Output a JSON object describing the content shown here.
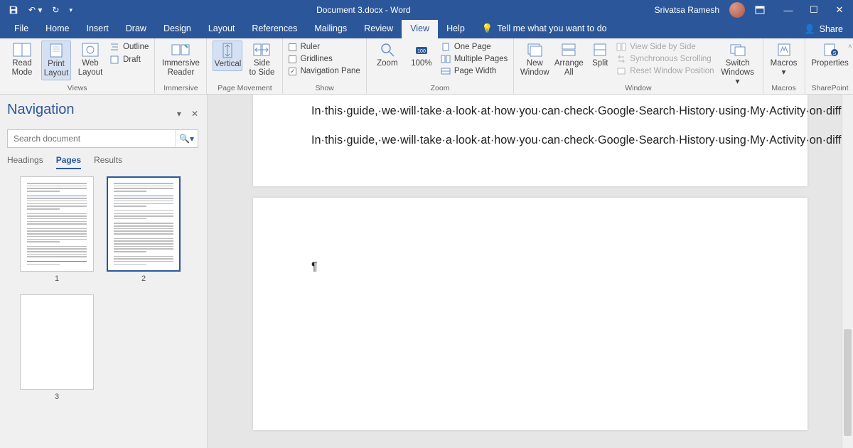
{
  "titlebar": {
    "doc_title": "Document 3.docx  -  Word",
    "user_name": "Srivatsa Ramesh"
  },
  "tabs": {
    "items": [
      "File",
      "Home",
      "Insert",
      "Draw",
      "Design",
      "Layout",
      "References",
      "Mailings",
      "Review",
      "View",
      "Help"
    ],
    "active": "View",
    "tell_me": "Tell me what you want to do",
    "share": "Share"
  },
  "ribbon": {
    "views": {
      "label": "Views",
      "read_mode": "Read\nMode",
      "print_layout": "Print\nLayout",
      "web_layout": "Web\nLayout",
      "outline": "Outline",
      "draft": "Draft"
    },
    "immersive": {
      "label": "Immersive",
      "reader": "Immersive\nReader"
    },
    "page_movement": {
      "label": "Page Movement",
      "vertical": "Vertical",
      "side": "Side\nto Side"
    },
    "show": {
      "label": "Show",
      "ruler": "Ruler",
      "gridlines": "Gridlines",
      "nav_pane": "Navigation Pane"
    },
    "zoom": {
      "label": "Zoom",
      "zoom": "Zoom",
      "hundred": "100%",
      "one_page": "One Page",
      "multiple": "Multiple Pages",
      "page_width": "Page Width"
    },
    "window": {
      "label": "Window",
      "new_window": "New\nWindow",
      "arrange_all": "Arrange\nAll",
      "split": "Split",
      "side_by_side": "View Side by Side",
      "sync": "Synchronous Scrolling",
      "reset": "Reset Window Position",
      "switch": "Switch\nWindows"
    },
    "macros": {
      "label": "Macros",
      "btn": "Macros"
    },
    "sharepoint": {
      "label": "SharePoint",
      "btn": "Properties"
    }
  },
  "nav": {
    "title": "Navigation",
    "search_placeholder": "Search document",
    "tabs": {
      "headings": "Headings",
      "pages": "Pages",
      "results": "Results"
    },
    "page_numbers": [
      "1",
      "2",
      "3"
    ]
  },
  "document": {
    "para1": "In·this·guide,·we·will·take·a·look·at·how·you·can·check·Google·Search·History·using·My·Activity·on·different·devices·like·Android,·iPhone/iPad,·and·computers.·Apart·from·checking·the·activities,·we·have·also·mentioned·how·you·can·get·more·details·of·the·activity·and·also·how·you·can·turn·off·this·feature·so·your·activities·are·not·tracked.\\¶",
    "para2": "In·this·guide,·we·will·take·a·look·at·how·you·can·check·Google·Search·History·using·My·Activity·on·different·devices·like·Android,·iPhone/iPad,·and·computers.·Apart·from·checking·the·activities,·we·have·also·mentioned·how·you·can·get·not·tracked.\\¶",
    "para3": "¶"
  }
}
